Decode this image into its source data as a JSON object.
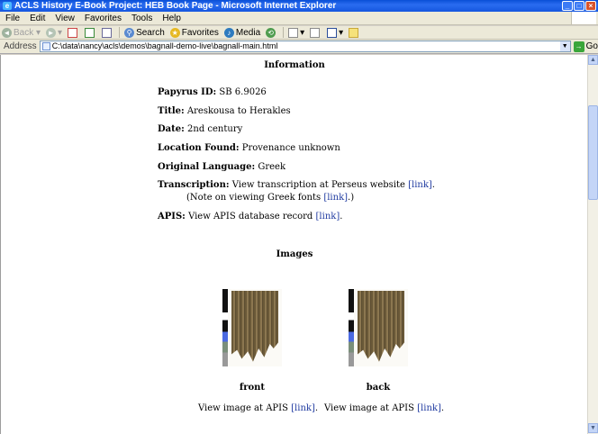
{
  "window": {
    "title": "ACLS History E-Book Project: HEB Book Page - Microsoft Internet Explorer"
  },
  "menu": [
    "File",
    "Edit",
    "View",
    "Favorites",
    "Tools",
    "Help"
  ],
  "toolbar": {
    "back": "Back",
    "search": "Search",
    "favorites": "Favorites",
    "media": "Media"
  },
  "address": {
    "label": "Address",
    "url": "C:\\data\\nancy\\acls\\demos\\bagnall-demo-live\\bagnall-main.html",
    "go": "Go"
  },
  "page": {
    "info_heading": "Information",
    "papyrus_label": "Papyrus ID:",
    "papyrus_value": "SB 6.9026",
    "title_label": "Title:",
    "title_value": "Areskousa to Herakles",
    "date_label": "Date:",
    "date_value": "2nd century",
    "location_label": "Location Found:",
    "location_value": "Provenance unknown",
    "language_label": "Original Language:",
    "language_value": "Greek",
    "transcription_label": "Transcription:",
    "transcription_text": "View transcription at Perseus website",
    "transcription_note_pre": "(Note on viewing Greek fonts",
    "transcription_note_post": ".)",
    "apis_label": "APIS:",
    "apis_text": "View APIS database record",
    "link_text": "[link]",
    "images_heading": "Images",
    "front_caption": "front",
    "back_caption": "back",
    "view_image_text": "View image at APIS"
  },
  "colors": {
    "link": "#1f3aa0",
    "titlebar": "#0a4fd6"
  }
}
